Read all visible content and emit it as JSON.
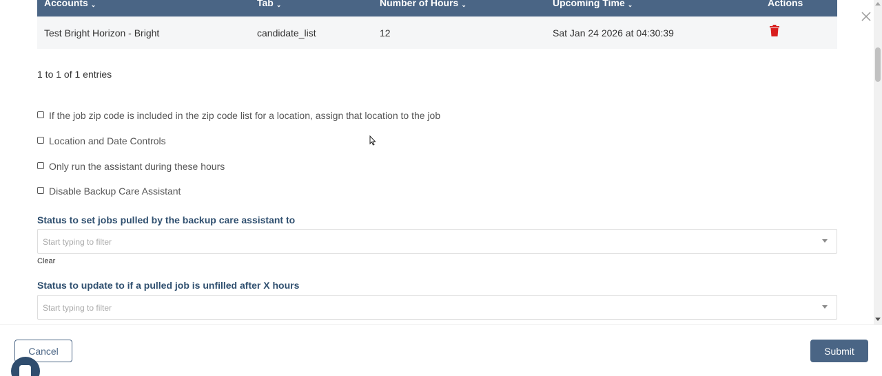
{
  "table": {
    "columns": [
      {
        "label": "Accounts",
        "sortable": true
      },
      {
        "label": "Tab",
        "sortable": true
      },
      {
        "label": "Number of Hours",
        "sortable": true
      },
      {
        "label": "Upcoming Time",
        "sortable": true
      },
      {
        "label": "Actions",
        "sortable": false
      }
    ],
    "rows": [
      {
        "account": "Test Bright Horizon - Bright",
        "tab": "candidate_list",
        "hours": "12",
        "upcoming_time": "Sat Jan 24 2026 at 04:30:39",
        "action_icon": "trash-icon"
      }
    ],
    "header_color": "#4a6585",
    "delete_color": "#d81e1e"
  },
  "entries_text": "1 to 1 of 1 entries",
  "options": [
    {
      "label": "If the job zip code is included in the zip code list for a location, assign that location to the job",
      "checked": false
    },
    {
      "label": "Location and Date Controls",
      "checked": false
    },
    {
      "label": "Only run the assistant during these hours",
      "checked": false
    },
    {
      "label": "Disable Backup Care Assistant",
      "checked": false
    }
  ],
  "status_pulled": {
    "title": "Status to set jobs pulled by the backup care assistant to",
    "placeholder": "Start typing to filter",
    "clear_label": "Clear"
  },
  "status_unfilled": {
    "title": "Status to update to if a pulled job is unfilled after X hours",
    "placeholder": "Start typing to filter"
  },
  "footer": {
    "cancel_label": "Cancel",
    "submit_label": "Submit",
    "accent": "#4a6585"
  },
  "icons": {
    "close": "close-icon",
    "sort": "sort-icon",
    "chat": "chat-icon"
  }
}
